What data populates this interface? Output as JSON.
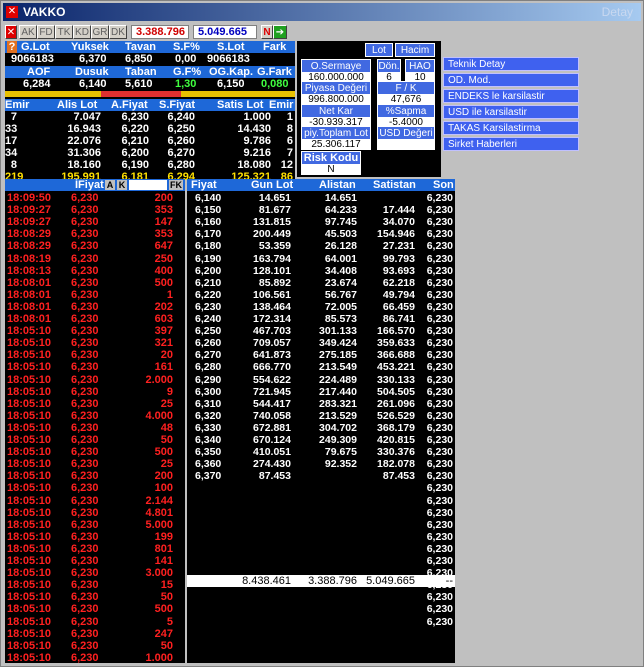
{
  "window": {
    "title": "VAKKO",
    "right_title": "Detay"
  },
  "toolbar": {
    "buttons": [
      "AK",
      "FD",
      "TK",
      "KD",
      "GR",
      "DK"
    ],
    "value1": "3.388.796",
    "value2": "5.049.665",
    "n_label": "N"
  },
  "summary": {
    "headers1": [
      "G.Lot",
      "Yuksek",
      "Tavan",
      "S.F%",
      "S.Lot",
      "Fark"
    ],
    "values1": [
      "9066183",
      "6,370",
      "6,850",
      "0,00",
      "9066183",
      ""
    ],
    "headers2": [
      "AOF",
      "Dusuk",
      "Taban",
      "G.F%",
      "OG.Kap.",
      "G.Fark"
    ],
    "values2": [
      "6,284",
      "6,140",
      "5,610",
      "1,30",
      "6,150",
      "0,080"
    ]
  },
  "depth": {
    "headers": [
      "Emir",
      "Alis Lot",
      "A.Fiyat",
      "S.Fiyat",
      "Satis Lot",
      "Emir"
    ],
    "rows": [
      [
        "7",
        "7.047",
        "6,230",
        "6,240",
        "1.000",
        "1"
      ],
      [
        "33",
        "16.943",
        "6,220",
        "6,250",
        "14.430",
        "8"
      ],
      [
        "17",
        "22.076",
        "6,210",
        "6,260",
        "9.786",
        "6"
      ],
      [
        "34",
        "31.306",
        "6,200",
        "6,270",
        "9.216",
        "7"
      ],
      [
        "8",
        "18.160",
        "6,190",
        "6,280",
        "18.080",
        "12"
      ]
    ],
    "total": [
      "219",
      "195.991",
      "6,181",
      "6,294",
      "125.321",
      "86"
    ]
  },
  "info_panel": {
    "tab_lot": "Lot",
    "tab_hacim": "Hacim",
    "o_sermaye_label": "O.Sermaye",
    "o_sermaye_value": "160.000.000",
    "don_label": "Dön.",
    "don_value": "6",
    "hao_label": "HAO",
    "hao_value": "10",
    "piyasa_label": "Piyasa Değeri",
    "piyasa_value": "996.800.000",
    "fk_label": "F / K",
    "fk_value": "47,676",
    "netkar_label": "Net Kar",
    "netkar_value": "-30.939.317",
    "sapma_label": "%Sapma",
    "sapma_value": "-5.4000",
    "piy_toplam_label": "piy.Toplam Lot",
    "piy_toplam_value": "25.306.117",
    "usd_label": "USD Değeri",
    "risk_label": "Risk Kodu",
    "risk_value": "N"
  },
  "menu": [
    "Teknik Detay",
    "OD. Mod.",
    "ENDEKS le karsilastir",
    "USD ile karsilastir",
    "TAKAS Karsilastirma",
    "Sirket Haberleri"
  ],
  "trades": {
    "header_fiyat": "İFiyat",
    "header_a": "A",
    "header_k": "K",
    "header_fk": "FK",
    "rows": [
      [
        "18:09:50",
        "6,230",
        "200"
      ],
      [
        "18:09:27",
        "6,230",
        "353"
      ],
      [
        "18:09:27",
        "6,230",
        "147"
      ],
      [
        "18:08:29",
        "6,230",
        "353"
      ],
      [
        "18:08:29",
        "6,230",
        "647"
      ],
      [
        "18:08:19",
        "6,230",
        "250"
      ],
      [
        "18:08:13",
        "6,230",
        "400"
      ],
      [
        "18:08:01",
        "6,230",
        "500"
      ],
      [
        "18:08:01",
        "6,230",
        "1"
      ],
      [
        "18:08:01",
        "6,230",
        "202"
      ],
      [
        "18:08:01",
        "6,230",
        "603"
      ],
      [
        "18:05:10",
        "6,230",
        "397"
      ],
      [
        "18:05:10",
        "6,230",
        "321"
      ],
      [
        "18:05:10",
        "6,230",
        "20"
      ],
      [
        "18:05:10",
        "6,230",
        "161"
      ],
      [
        "18:05:10",
        "6,230",
        "2.000"
      ],
      [
        "18:05:10",
        "6,230",
        "9"
      ],
      [
        "18:05:10",
        "6,230",
        "25"
      ],
      [
        "18:05:10",
        "6,230",
        "4.000"
      ],
      [
        "18:05:10",
        "6,230",
        "48"
      ],
      [
        "18:05:10",
        "6,230",
        "50"
      ],
      [
        "18:05:10",
        "6,230",
        "500"
      ],
      [
        "18:05:10",
        "6,230",
        "25"
      ],
      [
        "18:05:10",
        "6,230",
        "200"
      ],
      [
        "18:05:10",
        "6,230",
        "100"
      ],
      [
        "18:05:10",
        "6,230",
        "2.144"
      ],
      [
        "18:05:10",
        "6,230",
        "4.801"
      ],
      [
        "18:05:10",
        "6,230",
        "5.000"
      ],
      [
        "18:05:10",
        "6,230",
        "199"
      ],
      [
        "18:05:10",
        "6,230",
        "801"
      ],
      [
        "18:05:10",
        "6,230",
        "141"
      ],
      [
        "18:05:10",
        "6,230",
        "3.000"
      ],
      [
        "18:05:10",
        "6,230",
        "15"
      ],
      [
        "18:05:10",
        "6,230",
        "50"
      ],
      [
        "18:05:10",
        "6,230",
        "500"
      ],
      [
        "18:05:10",
        "6,230",
        "5"
      ],
      [
        "18:05:10",
        "6,230",
        "247"
      ],
      [
        "18:05:10",
        "6,230",
        "50"
      ],
      [
        "18:05:10",
        "6,230",
        "1.000"
      ]
    ]
  },
  "distribution": {
    "headers": [
      "Fiyat",
      "Gun Lot",
      "Alistan",
      "Satistan",
      "Son"
    ],
    "rows": [
      [
        "6,140",
        "14.651",
        "14.651",
        "",
        "6,230"
      ],
      [
        "6,150",
        "81.677",
        "64.233",
        "17.444",
        "6,230"
      ],
      [
        "6,160",
        "131.815",
        "97.745",
        "34.070",
        "6,230"
      ],
      [
        "6,170",
        "200.449",
        "45.503",
        "154.946",
        "6,230"
      ],
      [
        "6,180",
        "53.359",
        "26.128",
        "27.231",
        "6,230"
      ],
      [
        "6,190",
        "163.794",
        "64.001",
        "99.793",
        "6,230"
      ],
      [
        "6,200",
        "128.101",
        "34.408",
        "93.693",
        "6,230"
      ],
      [
        "6,210",
        "85.892",
        "23.674",
        "62.218",
        "6,230"
      ],
      [
        "6,220",
        "106.561",
        "56.767",
        "49.794",
        "6,230"
      ],
      [
        "6,230",
        "138.464",
        "72.005",
        "66.459",
        "6,230"
      ],
      [
        "6,240",
        "172.314",
        "85.573",
        "86.741",
        "6,230"
      ],
      [
        "6,250",
        "467.703",
        "301.133",
        "166.570",
        "6,230"
      ],
      [
        "6,260",
        "709.057",
        "349.424",
        "359.633",
        "6,230"
      ],
      [
        "6,270",
        "641.873",
        "275.185",
        "366.688",
        "6,230"
      ],
      [
        "6,280",
        "666.770",
        "213.549",
        "453.221",
        "6,230"
      ],
      [
        "6,290",
        "554.622",
        "224.489",
        "330.133",
        "6,230"
      ],
      [
        "6,300",
        "721.945",
        "217.440",
        "504.505",
        "6,230"
      ],
      [
        "6,310",
        "544.417",
        "283.321",
        "261.096",
        "6,230"
      ],
      [
        "6,320",
        "740.058",
        "213.529",
        "526.529",
        "6,230"
      ],
      [
        "6,330",
        "672.881",
        "304.702",
        "368.179",
        "6,230"
      ],
      [
        "6,340",
        "670.124",
        "249.309",
        "420.815",
        "6,230"
      ],
      [
        "6,350",
        "410.051",
        "79.675",
        "330.376",
        "6,230"
      ],
      [
        "6,360",
        "274.430",
        "92.352",
        "182.078",
        "6,230"
      ],
      [
        "6,370",
        "87.453",
        "",
        "87.453",
        "6,230"
      ]
    ],
    "extra_son": [
      "6,230",
      "6,230",
      "6,230",
      "6,230",
      "6,230",
      "6,230",
      "6,230",
      "6,230",
      "6,230",
      "6,230",
      "6,230",
      "6,230"
    ],
    "totals": [
      "8.438.461",
      "3.388.796",
      "5.049.665",
      "--"
    ]
  }
}
